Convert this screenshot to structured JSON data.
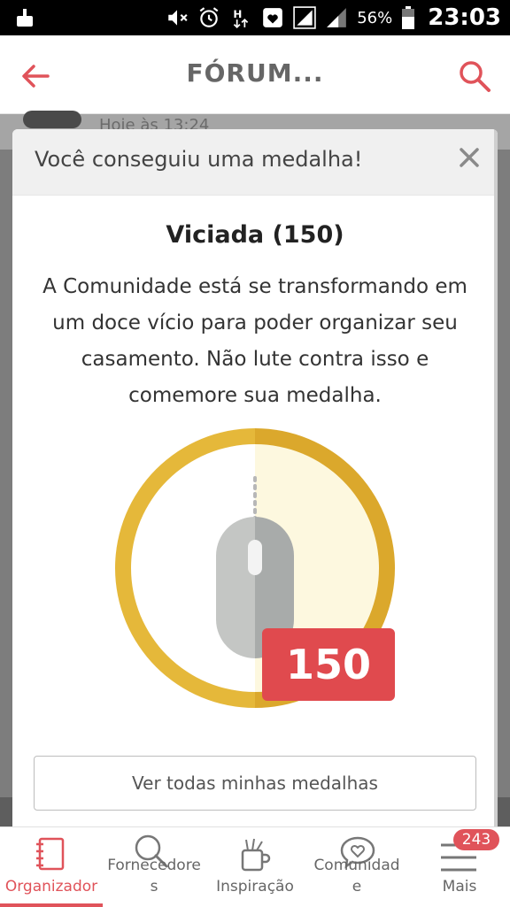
{
  "status_bar": {
    "battery_percent": "56%",
    "time": "23:03",
    "icons": [
      "broom-icon",
      "mute-icon",
      "alarm-icon",
      "data-icon",
      "heart-icon",
      "signal-icon",
      "signal-icon",
      "battery-icon"
    ]
  },
  "app_bar": {
    "title": "FÓRUM...",
    "accent_color": "#e0535a"
  },
  "background": {
    "row_time": "Hoje às 13:24"
  },
  "modal": {
    "header_title": "Você conseguiu uma medalha!",
    "medal_name": "Viciada (150)",
    "medal_description": "A Comunidade está se transformando em um doce vício para poder organizar seu casamento. Não lute contra isso e comemore sua medalha.",
    "medal_count": "150",
    "button_label": "Ver todas minhas medalhas",
    "colors": {
      "ring": "#e5b83a",
      "inner_light": "#fdf8df",
      "badge": "#e04a4e"
    }
  },
  "bottom_nav": {
    "items": [
      {
        "label": "Organizador",
        "icon": "notebook-icon",
        "active": true
      },
      {
        "label_line1": "Fornecedore",
        "label_line2": "s",
        "icon": "search-icon",
        "active": false
      },
      {
        "label": "Inspiração",
        "icon": "mug-icon",
        "active": false
      },
      {
        "label_line1": "Comunidad",
        "label_line2": "e",
        "icon": "heart-bubble-icon",
        "active": false
      },
      {
        "label": "Mais",
        "icon": "menu-icon",
        "active": false,
        "badge": "243"
      }
    ]
  }
}
